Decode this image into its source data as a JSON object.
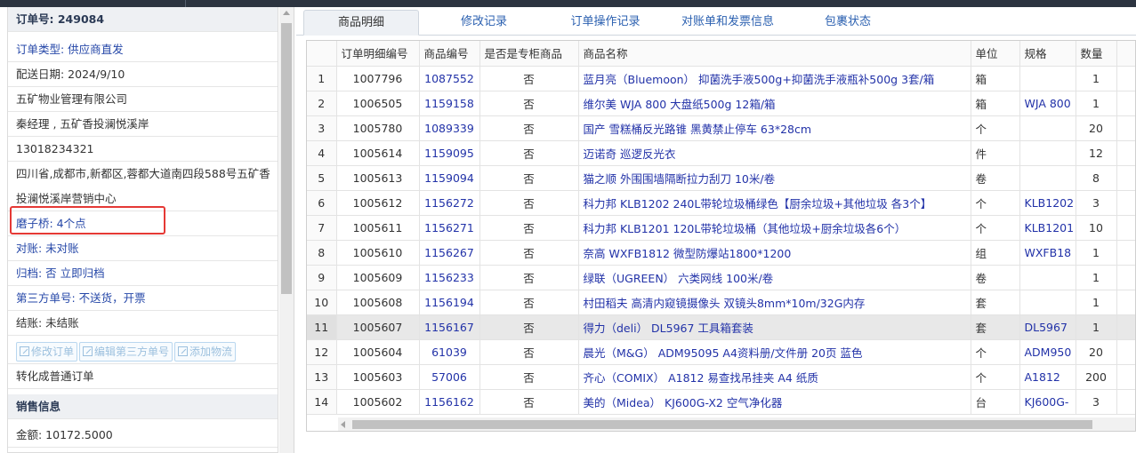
{
  "order": {
    "number_label": "订单号: 249084",
    "type": "订单类型: 供应商直发",
    "delivery_date": "配送日期: 2024/9/10",
    "company": "五矿物业管理有限公司",
    "contact": "秦经理 , 五矿香投澜悦溪岸",
    "phone": "13018234321",
    "address": "四川省,成都市,新都区,蓉都大道南四段588号五矿香投澜悦溪岸营销中心",
    "mozi_qiao": "磨子桥: 4个点",
    "reconcile": "对账: 未对账",
    "archive": "归档: 否 立即归档",
    "third_party": "第三方单号: 不送货，开票",
    "settlement": "结账: 未结账",
    "buttons": {
      "edit_order": "修改订单",
      "edit_third": "编辑第三方单号",
      "add_logistics": "添加物流"
    },
    "convert": "转化成普通订单",
    "sales_info": "销售信息",
    "amount": "金额: 10172.5000"
  },
  "tabs": [
    "商品明细",
    "修改记录",
    "订单操作记录",
    "对账单和发票信息",
    "包裹状态"
  ],
  "table": {
    "headers": [
      "",
      "订单明细编号",
      "商品编号",
      "是否是专柜商品",
      "商品名称",
      "单位",
      "规格",
      "数量"
    ],
    "rows": [
      [
        "1",
        "1007796",
        "1087552",
        "否",
        "蓝月亮（Bluemoon） 抑菌洗手液500g+抑菌洗手液瓶补500g 3套/箱",
        "箱",
        "",
        "1"
      ],
      [
        "2",
        "1006505",
        "1159158",
        "否",
        "维尔美 WJA 800 大盘纸500g 12箱/箱",
        "箱",
        "WJA 800",
        "1"
      ],
      [
        "3",
        "1005780",
        "1089339",
        "否",
        "国产 雪糕桶反光路锥 黑黄禁止停车 63*28cm",
        "个",
        "",
        "20"
      ],
      [
        "4",
        "1005614",
        "1159095",
        "否",
        "迈诺奇 巡逻反光衣",
        "件",
        "",
        "12"
      ],
      [
        "5",
        "1005613",
        "1159094",
        "否",
        "猫之顺 外围围墙隔断拉力刮刀 10米/卷",
        "卷",
        "",
        "8"
      ],
      [
        "6",
        "1005612",
        "1156272",
        "否",
        "科力邦 KLB1202 240L带轮垃圾桶绿色【厨余垃圾+其他垃圾 各3个】",
        "个",
        "KLB1202",
        "3"
      ],
      [
        "7",
        "1005611",
        "1156271",
        "否",
        "科力邦 KLB1201 120L带轮垃圾桶（其他垃圾+厨余垃圾各6个）",
        "个",
        "KLB1201",
        "10"
      ],
      [
        "8",
        "1005610",
        "1156267",
        "否",
        "奈高 WXFB1812 微型防爆站1800*1200",
        "组",
        "WXFB18",
        "1"
      ],
      [
        "9",
        "1005609",
        "1156233",
        "否",
        "绿联（UGREEN） 六类网线 100米/卷",
        "卷",
        "",
        "1"
      ],
      [
        "10",
        "1005608",
        "1156194",
        "否",
        "村田稻夫 高清内窥镜摄像头 双镜头8mm*10m/32G内存",
        "套",
        "",
        "1"
      ],
      [
        "11",
        "1005607",
        "1156167",
        "否",
        "得力（deli） DL5967 工具箱套装",
        "套",
        "DL5967",
        "1"
      ],
      [
        "12",
        "1005604",
        "61039",
        "否",
        "晨光（M&G） ADM95095 A4资料册/文件册 20页 蓝色",
        "个",
        "ADM950",
        "20"
      ],
      [
        "13",
        "1005603",
        "57006",
        "否",
        "齐心（COMIX） A1812 易查找吊挂夹 A4 纸质",
        "个",
        "A1812",
        "200"
      ],
      [
        "14",
        "1005602",
        "1156162",
        "否",
        "美的（Midea） KJ600G-X2 空气净化器",
        "台",
        "KJ600G-",
        "3"
      ]
    ]
  }
}
